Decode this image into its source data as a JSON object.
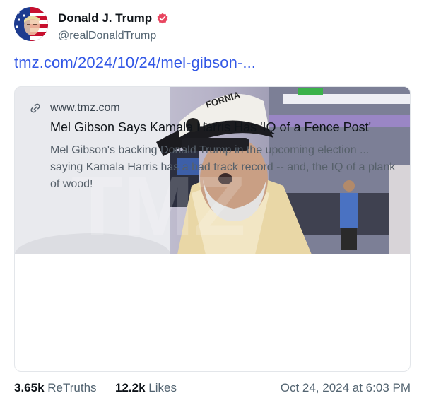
{
  "author": {
    "display_name": "Donald J. Trump",
    "handle": "@realDonaldTrump"
  },
  "post": {
    "link_text": "tmz.com/2024/10/24/mel-gibson-..."
  },
  "link_card": {
    "domain": "www.tmz.com",
    "title": "Mel Gibson Says Kamala Harris Has 'IQ of a Fence Post'",
    "description": "Mel Gibson's backing Donald Trump in the upcoming election ... saying Kamala Harris has a bad track record -- and, the IQ of a plank of wood!",
    "image_watermark": "TMZ"
  },
  "stats": {
    "retruths_count": "3.65k",
    "retruths_label": "ReTruths",
    "likes_count": "12.2k",
    "likes_label": "Likes"
  },
  "timestamp": "Oct 24, 2024 at 6:03 PM",
  "colors": {
    "link": "#3257e6",
    "verified_badge": "#e8455f",
    "muted_text": "#536471"
  },
  "icons": {
    "verified": "verified-badge-icon",
    "link": "link-icon"
  }
}
